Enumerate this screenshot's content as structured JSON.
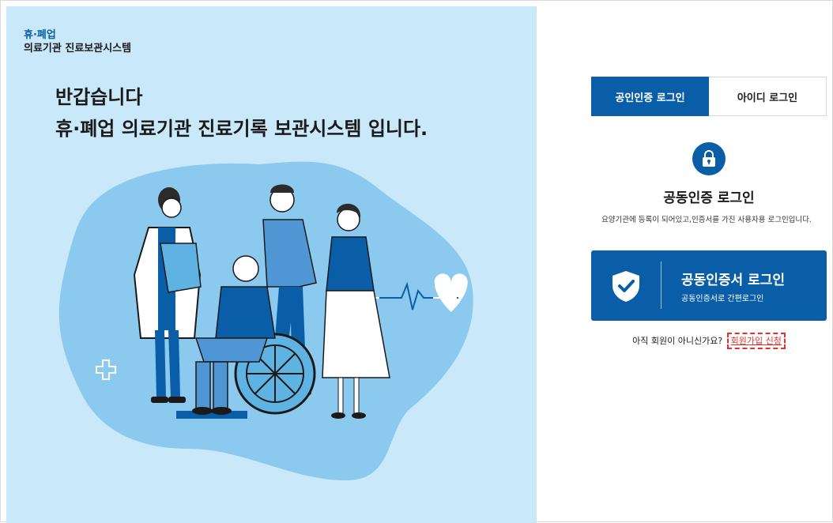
{
  "brand": {
    "name": "휴·폐업",
    "subtitle": "의료기관 진료보관시스템"
  },
  "hero": {
    "line1": "반갑습니다",
    "line2": "휴·폐업 의료기관 진료기록 보관시스템 입니다."
  },
  "tabs": [
    {
      "label": "공인인증 로그인",
      "active": true
    },
    {
      "label": "아이디 로그인",
      "active": false
    }
  ],
  "login": {
    "title": "공동인증 로그인",
    "description": "요양기관에 등록이 되어있고,인증서를 가진 사용자용 로그인입니다.",
    "cert_button_label": "공동인증서 로그인",
    "cert_button_sub": "공동인증서로 간편로그인",
    "signup_prompt": "아직 회원이 아니신가요?",
    "signup_link": "회원가입 신청"
  },
  "colors": {
    "primary": "#0a5ea8",
    "left_background": "#c9e8f9",
    "blob": "#8cc9ee",
    "signup_highlight": "#e0322f"
  },
  "icons": {
    "lock": "lock-icon",
    "shield": "shield-check-icon",
    "heart": "heartbeat-icon",
    "cross": "medical-cross-icon"
  }
}
